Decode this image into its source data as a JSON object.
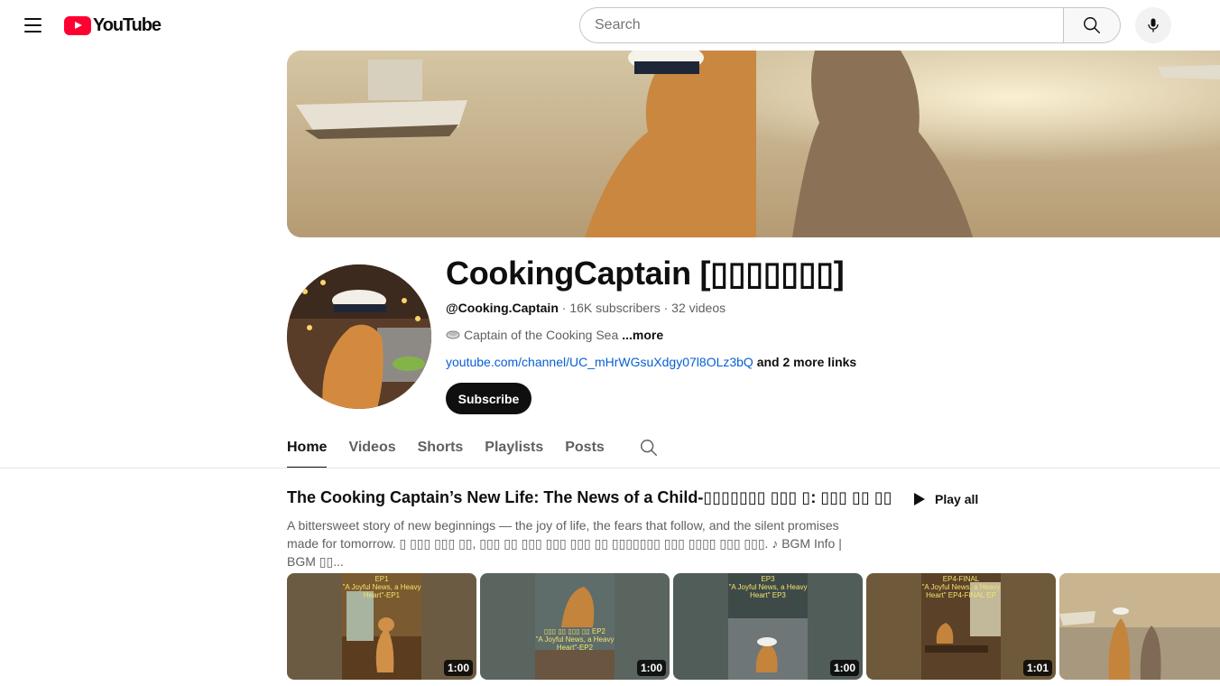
{
  "header": {
    "logo_text": "YouTube",
    "search_placeholder": "Search"
  },
  "channel": {
    "name": "CookingCaptain [▯▯▯▯▯▯▯]",
    "handle": "@Cooking.Captain",
    "subscribers": "16K subscribers",
    "videos": "32 videos",
    "description": "Captain of the Cooking Sea",
    "description_more": "...more",
    "link": "youtube.com/channel/UC_mHrWGsuXdgy07l8OLz3bQ",
    "more_links": "and 2 more links",
    "subscribe_label": "Subscribe"
  },
  "tabs": [
    {
      "label": "Home",
      "active": true
    },
    {
      "label": "Videos"
    },
    {
      "label": "Shorts"
    },
    {
      "label": "Playlists"
    },
    {
      "label": "Posts"
    }
  ],
  "shelf": {
    "title": "The Cooking Captain’s New Life: The News of a Child-▯▯▯▯▯▯▯ ▯▯▯ ▯: ▯▯▯ ▯▯ ▯▯",
    "play_all": "Play all",
    "description_1": "A bittersweet story of new beginnings — the joy of life, the fears that follow, and the silent promises made for tomorrow. ▯ ▯▯▯ ▯▯▯ ▯▯, ▯▯▯ ▯▯ ▯▯▯ ▯▯▯ ▯▯▯ ▯▯ ▯▯▯▯▯▯▯ ▯▯▯ ▯▯▯▯ ▯▯▯ ▯▯▯. ♪ BGM Info | BGM ▯▯..."
  },
  "videos": [
    {
      "caption_1": "EP1",
      "caption_2": "\"A Joyful News, a Heavy Heart\"-EP1",
      "duration": "1:00"
    },
    {
      "caption_1": "▯▯▯ ▯▯ ▯▯▯ ▯▯ EP2",
      "caption_2": "\"A Joyful News, a Heavy Heart\"-EP2",
      "duration": "1:00"
    },
    {
      "caption_1": "EP3",
      "caption_2": "\"A Joyful News, a Heavy Heart\" EP3",
      "duration": "1:00"
    },
    {
      "caption_1": "EP4-FINAL",
      "caption_2": "\"A Joyful News, a Heavy Heart\" EP4-FINAL EP",
      "duration": "1:01"
    },
    {
      "caption_1": "",
      "caption_2": "",
      "duration": ""
    }
  ],
  "colors": {
    "brand_red": "#ff0033",
    "link_blue": "#065fd4",
    "text_primary": "#0f0f0f",
    "text_secondary": "#606060"
  }
}
